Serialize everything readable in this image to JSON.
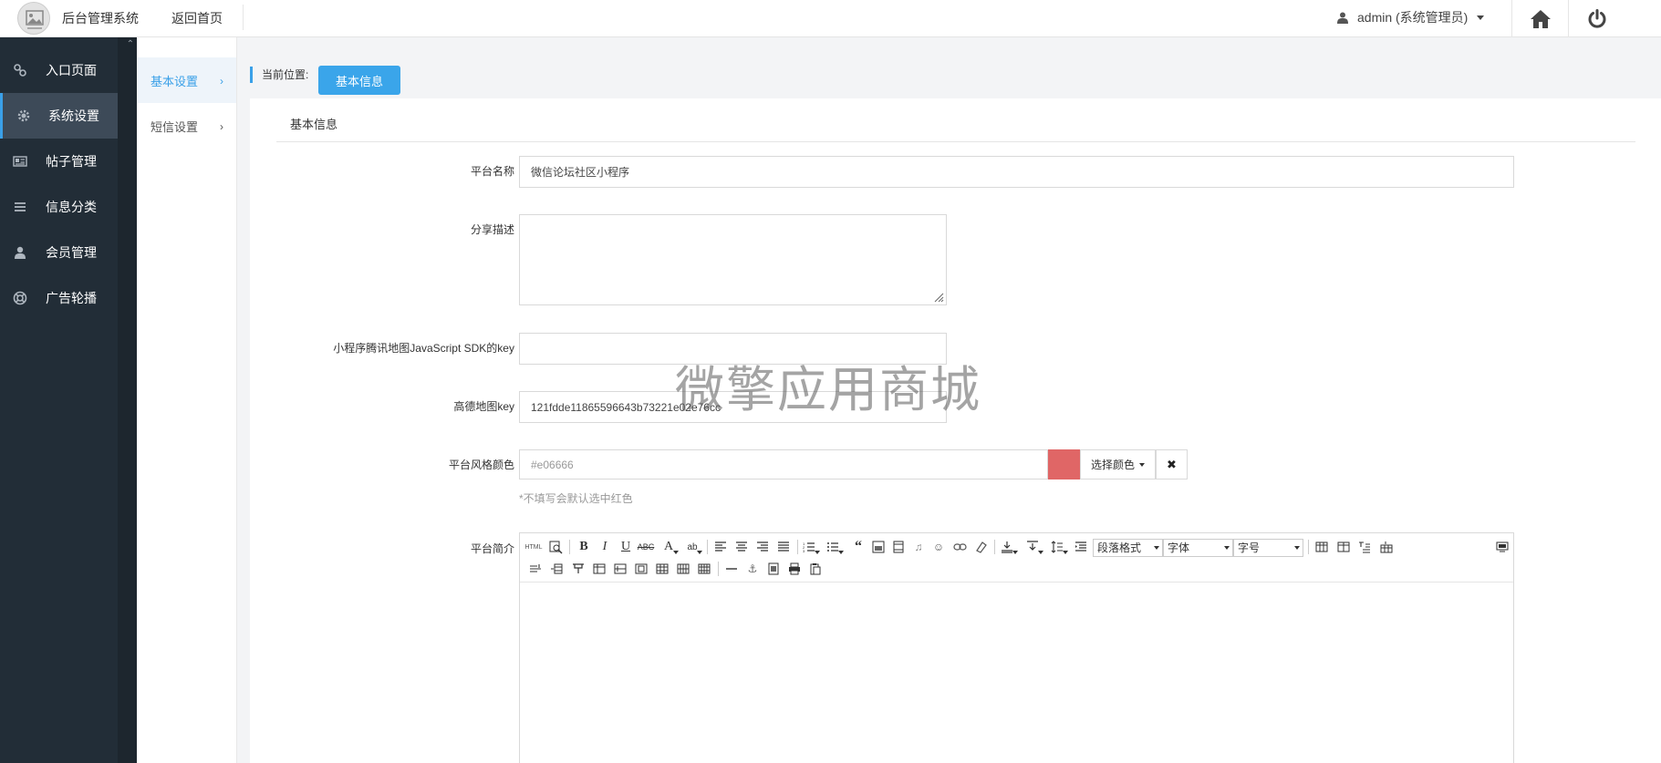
{
  "header": {
    "brand": "后台管理系统",
    "back_home": "返回首页",
    "user": "admin (系统管理员)"
  },
  "sidebar": {
    "items": [
      {
        "label": "入口页面",
        "icon": "link-icon"
      },
      {
        "label": "系统设置",
        "icon": "gear-icon"
      },
      {
        "label": "帖子管理",
        "icon": "newspaper-icon"
      },
      {
        "label": "信息分类",
        "icon": "list-icon"
      },
      {
        "label": "会员管理",
        "icon": "user-icon"
      },
      {
        "label": "广告轮播",
        "icon": "lifebuoy-icon"
      }
    ]
  },
  "subnav": {
    "items": [
      {
        "label": "基本设置"
      },
      {
        "label": "短信设置"
      }
    ]
  },
  "breadcrumb": {
    "label": "当前位置:",
    "current": "基本信息"
  },
  "panel": {
    "title": "基本信息"
  },
  "form": {
    "platform_name_label": "平台名称",
    "platform_name_value": "微信论坛社区小程序",
    "share_desc_label": "分享描述",
    "share_desc_value": "",
    "tencent_map_label": "小程序腾讯地图JavaScript SDK的key",
    "tencent_map_value": "",
    "amap_label": "高德地图key",
    "amap_value": "121fdde11865596643b73221e02e76cc",
    "color_label": "平台风格颜色",
    "color_placeholder": "#e06666",
    "color_swatch": "#e06666",
    "pick_color_label": "选择颜色",
    "clear_symbol": "✖",
    "color_hint": "*不填写会默认选中红色",
    "intro_label": "平台简介"
  },
  "editor": {
    "paragraph_select": "段落格式",
    "font_select": "字体",
    "size_select": "字号",
    "html_label": "HTML"
  },
  "watermark": "微擎应用商城",
  "colors": {
    "accent": "#3aa0e8",
    "sidebar_bg": "#222d37"
  }
}
